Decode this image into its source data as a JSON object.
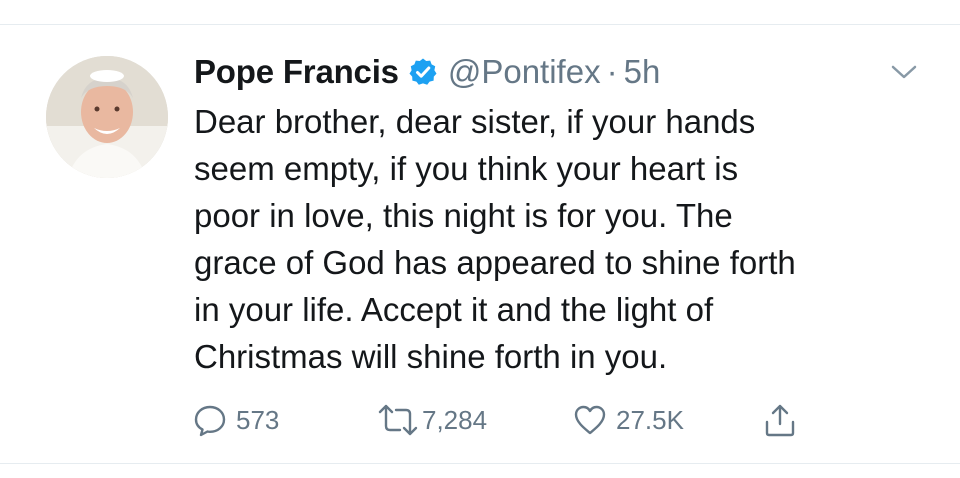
{
  "tweet": {
    "author": {
      "display_name": "Pope Francis",
      "handle": "@Pontifex",
      "verified": true
    },
    "separator": "·",
    "timestamp": "5h",
    "text_lines": [
      "Dear brother, dear sister, if your hands",
      "seem empty, if you think your heart is",
      "poor in love, this night is for you. The",
      "grace of God has appeared to shine forth",
      "in your life. Accept it and the light of",
      "Christmas will shine forth in you."
    ],
    "actions": {
      "replies": "573",
      "retweets": "7,284",
      "likes": "27.5K"
    }
  },
  "colors": {
    "text": "#14171a",
    "secondary": "#657786",
    "verified_blue": "#1da1f2",
    "divider": "#e6ecf0"
  },
  "icons": [
    "verified-badge-icon",
    "chevron-down-icon",
    "reply-icon",
    "retweet-icon",
    "like-icon",
    "share-icon"
  ]
}
